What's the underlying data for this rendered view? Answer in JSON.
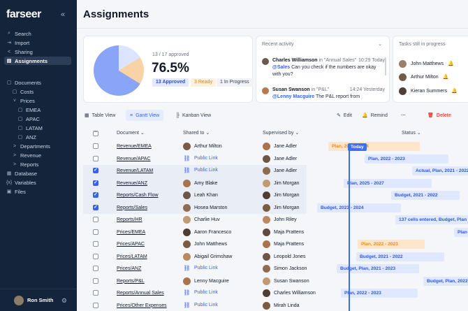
{
  "sidebar": {
    "logo": "farseer",
    "collapse_icon": "«",
    "items": [
      {
        "icon": "⌕",
        "label": "Search"
      },
      {
        "icon": "⇥",
        "label": "Import"
      },
      {
        "icon": "<",
        "label": "Sharing"
      },
      {
        "icon": "▤",
        "label": "Assignments"
      },
      {
        "icon": "▢",
        "label": "Documents"
      },
      {
        "icon": "▢",
        "label": "Costs"
      },
      {
        "icon": "˅",
        "label": "Prices"
      },
      {
        "icon": "▢",
        "label": "EMEA"
      },
      {
        "icon": "▢",
        "label": "APAC"
      },
      {
        "icon": "▢",
        "label": "LATAM"
      },
      {
        "icon": "▢",
        "label": "ANZ"
      },
      {
        "icon": ">",
        "label": "Departments"
      },
      {
        "icon": ">",
        "label": "Revenue"
      },
      {
        "icon": ">",
        "label": "Reports"
      },
      {
        "icon": "▦",
        "label": "Database"
      },
      {
        "icon": "{x}",
        "label": "Variables"
      },
      {
        "icon": "▣",
        "label": "Files"
      }
    ],
    "user_name": "Ron Smith",
    "gear_icon": "⚙"
  },
  "page": {
    "title": "Assignments"
  },
  "summary": {
    "caption": "13 / 17 approved",
    "percent": "76.5%",
    "approved_fraction": 0.765,
    "pills": {
      "approved": "13 Approved",
      "ready": "3 Ready",
      "in_progress": "1 In Progress"
    }
  },
  "activity": {
    "title": "Recent activity",
    "chevron": "⌄",
    "items": [
      {
        "name": "Charles Williamson",
        "in": " in \"Annual Sales\"",
        "time": "10:29 Today",
        "mention": "@Sales",
        "text": " Can you check if the numbers are okay with you?"
      },
      {
        "name": "Susan Swanson",
        "in": " in \"P&L\"",
        "time": "14:24 Yesterday",
        "mention": "@Lenny Macguire",
        "text": " The P&L report from"
      }
    ]
  },
  "tasks": {
    "title": "Tasks still in progress",
    "items": [
      "John Matthews",
      "Arthur Milton",
      "Kieran Summers"
    ],
    "bell": "🔔"
  },
  "toolbar": {
    "table_view": "Table View",
    "gantt_view": "Gantt View",
    "kanban_view": "Kanban View",
    "edit": "Edit",
    "remind": "Remind",
    "more": "···",
    "delete": "Delete"
  },
  "table": {
    "headers": {
      "document": "Document",
      "shared_to": "Shared to",
      "supervised_by": "Supervised by",
      "status": "Status"
    },
    "sort_chevron": "⌄",
    "rows": [
      {
        "doc": "Revenue/EMEA",
        "shared": "Arthur Milton",
        "sup": "Jane Adler",
        "checked": false
      },
      {
        "doc": "Revenue/APAC",
        "shared": "Public Link",
        "sup": "Jane Adler",
        "checked": false
      },
      {
        "doc": "Revenue/LATAM",
        "shared": "Public Link",
        "sup": "Jane Adler",
        "checked": true
      },
      {
        "doc": "Revenue/ANZ",
        "shared": "Amy Blake",
        "sup": "Jim Morgan",
        "checked": true
      },
      {
        "doc": "Reports/Cash Flow",
        "shared": "Leah Khan",
        "sup": "Jim Morgan",
        "checked": true
      },
      {
        "doc": "Reports/Sales",
        "shared": "Hosea Marston",
        "sup": "Jim Morgan",
        "checked": true
      },
      {
        "doc": "Reports/HR",
        "shared": "Charlie Huv",
        "sup": "John Riley",
        "checked": false
      },
      {
        "doc": "Prices/EMEA",
        "shared": "Aaron Francesco",
        "sup": "Maja Prattens",
        "checked": false
      },
      {
        "doc": "Prices/APAC",
        "shared": "John Matthews",
        "sup": "Maja Prattens",
        "checked": false
      },
      {
        "doc": "Prices/LATAM",
        "shared": "Abigail Grimshaw",
        "sup": "Leopold Jones",
        "checked": false
      },
      {
        "doc": "Prices/ANZ",
        "shared": "Public Link",
        "sup": "Simon Jackson",
        "checked": false
      },
      {
        "doc": "Reports/P&L",
        "shared": "Lenny Macguire",
        "sup": "Susan Swanson",
        "checked": false
      },
      {
        "doc": "Reports/Annual Sales",
        "shared": "Public Link",
        "sup": "Charles Williamson",
        "checked": false
      },
      {
        "doc": "Prices/Other Expenses",
        "shared": "Public Link",
        "sup": "Mirah Linda",
        "checked": false
      }
    ]
  },
  "gantt": {
    "today_label": "Today",
    "bars": [
      {
        "label": "Plan, 2023 - 2024",
        "color": "orange"
      },
      {
        "label": "Plan, 2022 - 2023",
        "color": "blue"
      },
      {
        "label": "Actual, Plan, 2021 - 2022",
        "color": "blue"
      },
      {
        "label": "Plan, 2025 - 2027",
        "color": "blue"
      },
      {
        "label": "Budget, 2021 - 2022",
        "color": "blue"
      },
      {
        "label": "Budget, 2023 - 2024",
        "color": "blue"
      },
      {
        "label": "137 cells entered, Budget, Plan",
        "color": "blue"
      },
      {
        "label": "Plan",
        "color": "blue"
      },
      {
        "label": "Plan, 2022 - 2023",
        "color": "orange"
      },
      {
        "label": "Budget, 2021 - 2022",
        "color": "blue"
      },
      {
        "label": "Budget, Plan, 2021 - 2023",
        "color": "blue"
      },
      {
        "label": "Budget, Plan, 2022",
        "color": "blue"
      },
      {
        "label": "Plan, 2022 - 2023",
        "color": "blue"
      }
    ]
  }
}
